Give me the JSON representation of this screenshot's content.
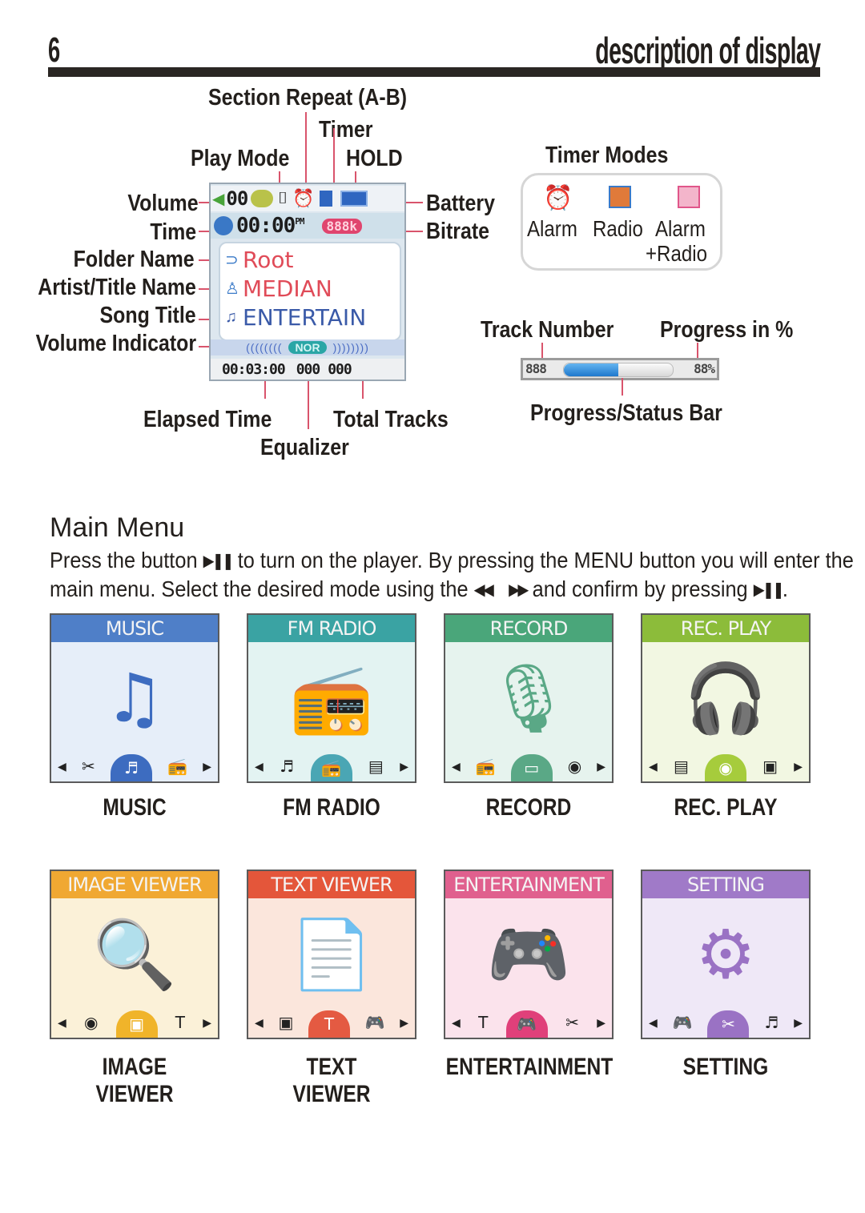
{
  "header": {
    "page_number": "6",
    "title": "description of display"
  },
  "display_diagram": {
    "labels": {
      "section_repeat": "Section Repeat (A-B)",
      "timer": "Timer",
      "play_mode": "Play Mode",
      "hold": "HOLD",
      "volume": "Volume",
      "time": "Time",
      "folder_name": "Folder Name",
      "artist_title_name": "Artist/Title Name",
      "song_title": "Song Title",
      "volume_indicator": "Volume Indicator",
      "battery": "Battery",
      "bitrate": "Bitrate",
      "elapsed_time": "Elapsed Time",
      "equalizer": "Equalizer",
      "total_tracks": "Total Tracks"
    },
    "lcd": {
      "volume_value": "00",
      "clock": "00:00",
      "clock_suffix": "PM",
      "bitrate": "888k",
      "folder": "Root",
      "artist": "MEDIAN",
      "song": "ENTERTAIN",
      "eq_mode": "NOR",
      "elapsed": "00:03:00",
      "track_current": "000",
      "track_total": "000"
    },
    "icons": {
      "volume": "speaker-icon",
      "play_mode": "repeat-mode-icon",
      "section_repeat": "ab-repeat-icon",
      "timer": "alarm-clock-icon",
      "hold": "lock-icon",
      "battery": "battery-icon",
      "time": "clock-icon",
      "folder": "folder-icon",
      "artist": "person-icon",
      "song": "music-note-icon"
    }
  },
  "timer_modes": {
    "title": "Timer Modes",
    "modes": [
      {
        "label": "Alarm",
        "icon": "alarm-clock-icon",
        "color": "#4a8fd0"
      },
      {
        "label": "Radio",
        "icon": "radio-timer-icon",
        "color": "#e07a3a"
      },
      {
        "label": "Alarm +Radio",
        "label_line1": "Alarm",
        "label_line2": "+Radio",
        "icon": "alarm-radio-icon",
        "color": "#e0568a"
      }
    ]
  },
  "progress_diagram": {
    "track_number_label": "Track Number",
    "progress_label": "Progress in %",
    "bar_label": "Progress/Status Bar",
    "track_value": "888",
    "percent_value": "88%",
    "fill_fraction": 0.5
  },
  "main_menu": {
    "title": "Main Menu",
    "line1_before": "Press the button",
    "line1_after": "to turn on the player. By pressing the MENU button you will enter the",
    "line2_before": "main menu. Select the desired mode using the",
    "line2_after": "and confirm by pressing",
    "line2_end": ".",
    "play_pause_glyph": "▶❚❚",
    "prev_glyph": "◀◀",
    "next_glyph": "▶▶",
    "items": [
      {
        "header": "MUSIC",
        "label_line1": "MUSIC",
        "label_line2": "",
        "art": "♫",
        "nav_left": "✂",
        "nav_active": "♬",
        "nav_right": "📻",
        "head_color": "#4f7fc8",
        "body_color": "#e6eef9",
        "accent": "#3d6cc0"
      },
      {
        "header": "FM RADIO",
        "label_line1": "FM RADIO",
        "label_line2": "",
        "art": "📻",
        "nav_left": "♬",
        "nav_active": "📻",
        "nav_right": "▤",
        "head_color": "#3aa3a3",
        "body_color": "#e3f3f2",
        "accent": "#4aa6b4"
      },
      {
        "header": "RECORD",
        "label_line1": "RECORD",
        "label_line2": "",
        "art": "🎙",
        "nav_left": "📻",
        "nav_active": "▭",
        "nav_right": "◉",
        "head_color": "#4aa67a",
        "body_color": "#e6f3ee",
        "accent": "#5aa886"
      },
      {
        "header": "REC. PLAY",
        "label_line1": "REC. PLAY",
        "label_line2": "",
        "art": "🎧",
        "nav_left": "▤",
        "nav_active": "◉",
        "nav_right": "▣",
        "head_color": "#8cbc3a",
        "body_color": "#f2f7e2",
        "accent": "#a6cc3c"
      },
      {
        "header": "IMAGE VIEWER",
        "label_line1": "IMAGE",
        "label_line2": "VIEWER",
        "art": "🔍",
        "nav_left": "◉",
        "nav_active": "▣",
        "nav_right": "T",
        "head_color": "#f0a832",
        "body_color": "#fbf1d8",
        "accent": "#f0b42a"
      },
      {
        "header": "TEXT VIEWER",
        "label_line1": "TEXT",
        "label_line2": "VIEWER",
        "art": "📄",
        "nav_left": "▣",
        "nav_active": "T",
        "nav_right": "🎮",
        "head_color": "#e4563a",
        "body_color": "#fbe6dc",
        "accent": "#e45a42"
      },
      {
        "header": "ENTERTAINMENT",
        "label_line1": "ENTERTAINMENT",
        "label_line2": "",
        "art": "🎮",
        "nav_left": "T",
        "nav_active": "🎮",
        "nav_right": "✂",
        "head_color": "#e0608e",
        "body_color": "#fbe3ec",
        "accent": "#e0407a"
      },
      {
        "header": "SETTING",
        "label_line1": "SETTING",
        "label_line2": "",
        "art": "⚙",
        "nav_left": "🎮",
        "nav_active": "✂",
        "nav_right": "♬",
        "head_color": "#a07ac8",
        "body_color": "#efe8f7",
        "accent": "#9a72c4"
      }
    ]
  }
}
